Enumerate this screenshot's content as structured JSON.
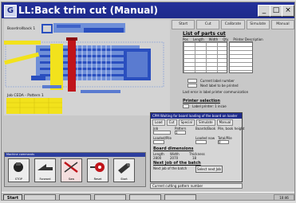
{
  "window": {
    "title": "LL:Back trim cut  (Manual)",
    "controls": {
      "minimize": "_",
      "maximize": "□",
      "close": "×"
    }
  },
  "toolbar": {
    "buttons": [
      "Start",
      "Cut",
      "Calibrate",
      "Simulate",
      "Manual"
    ]
  },
  "machine": {
    "label_top": "Boardrollback 1",
    "label_job": "Job CEDA - Pattern 1"
  },
  "list_panel": {
    "title": "List of parts cut",
    "headers": [
      "Pos",
      "Length",
      "Width",
      "Qty",
      "Printer Description"
    ],
    "current_label": "Current label number",
    "next_label": "Next label to be printed",
    "last_note": "Last error in label printer communication",
    "printer_selection": "Printer selection",
    "printer_name": "Label printer: 1 incae"
  },
  "dialog": {
    "title": "CPM Waiting for board loading of the board on loader",
    "tabs": [
      "Load",
      "Cut",
      "Special",
      "Simulate",
      "Manual"
    ],
    "fields": {
      "job": "Job",
      "pattern": "Pattern",
      "pattern_value": "1",
      "boards_book": "Boards/Book",
      "pile_height": "Pile, book height",
      "loaded_pile": "Loaded/Pile",
      "loaded_now": "Loaded now",
      "total_pile": "Total/Pile",
      "total_value": "0"
    },
    "board_dimensions": "Board dimensions",
    "length_label": "Length",
    "length_value": "2800",
    "width_label": "Width",
    "width_value": "2070",
    "thickness_label": "Thickness",
    "thickness_value": "18",
    "next_job": "Next job of the batch",
    "next_job_sub": "Next job of the batch",
    "select_button": "Select next Job",
    "status": "Current cutting pattern number"
  },
  "command_panel": {
    "title": "Machine commands",
    "buttons": [
      "STOP",
      "Forward",
      "Saw",
      "Reset",
      "Start"
    ]
  },
  "taskbar": {
    "start": "Start",
    "clock": "10:46"
  },
  "colors": {
    "title_bar": "#1d2a8a",
    "machine_blue": "#2a4fbf",
    "machine_red": "#c0141a",
    "machine_yellow": "#f2e21c"
  }
}
